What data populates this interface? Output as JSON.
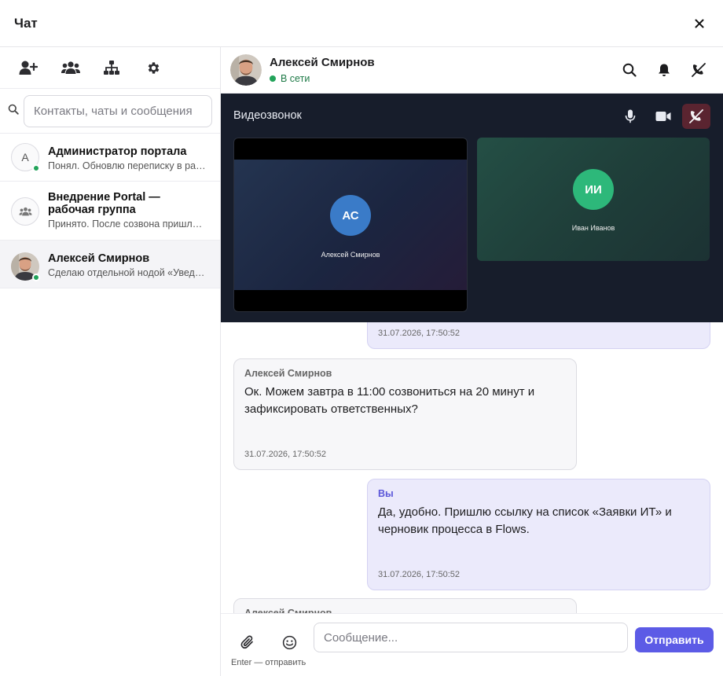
{
  "window": {
    "title": "Чат",
    "close_label": "×"
  },
  "sidebar": {
    "tools": [
      {
        "icon": "add-user-icon"
      },
      {
        "icon": "group-icon"
      },
      {
        "icon": "org-structure-icon"
      },
      {
        "icon": "gear-icon"
      }
    ],
    "search": {
      "placeholder": "Контакты, чаты и сообщения"
    },
    "chats": [
      {
        "name": "Администратор портала",
        "preview": "Понял. Обновлю переписку в рабочей группе.",
        "avatar_letter": "А",
        "online": true,
        "active": false
      },
      {
        "name": "Внедрение Portal — рабочая группа",
        "preview": "Принято. После созвона пришлю итоги.",
        "avatar_icon": "group-icon",
        "online": false,
        "active": false
      },
      {
        "name": "Алексей Смирнов",
        "preview": "Сделаю отдельной нодой «Уведомления».",
        "avatar_photo": true,
        "online": true,
        "active": true
      }
    ]
  },
  "header": {
    "name": "Алексей Смирнов",
    "status": "В сети",
    "actions": [
      "search-icon",
      "bell-icon",
      "end-call-icon"
    ]
  },
  "video": {
    "title": "Видеозвонок",
    "controls": [
      "microphone-icon",
      "camera-icon",
      "end-call-icon"
    ],
    "participants": [
      {
        "initials": "АС",
        "name": "Алексей Смирнов",
        "color": "#3a7bc8"
      },
      {
        "initials": "ИИ",
        "name": "Иван Иванов",
        "color": "#2db87a"
      }
    ]
  },
  "messages": [
    {
      "direction": "out",
      "author": "",
      "text": "",
      "time": "31.07.2026, 17:50:52"
    },
    {
      "direction": "in",
      "author": "Алексей Смирнов",
      "text": "Ок. Можем завтра в 11:00 созвониться на 20 минут и зафиксировать ответственных?",
      "time": "31.07.2026, 17:50:52"
    },
    {
      "direction": "out",
      "author": "Вы",
      "text": "Да, удобно. Пришлю ссылку на список «Заявки ИТ» и черновик процесса в Flows.",
      "time": "31.07.2026, 17:50:52"
    },
    {
      "direction": "in",
      "author": "Алексей Смирнов",
      "text": "",
      "time": ""
    }
  ],
  "composer": {
    "placeholder": "Сообщение...",
    "send_label": "Отправить",
    "hint": "Enter — отправить"
  },
  "colors": {
    "accent": "#5c5be6",
    "online": "#22a35a",
    "video_bg": "#171d2b",
    "end_call_bg": "#5a2430"
  }
}
